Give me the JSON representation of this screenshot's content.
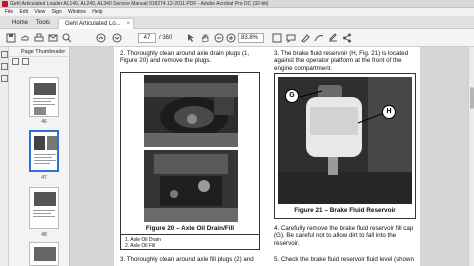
{
  "window": {
    "title": "Gehl Articulated Loader AL140, AL240, AL340 Service Manual 918274 12-2011.PDF - Adobe Acrobat Pro DC (32-bit)"
  },
  "menu": {
    "items": [
      "File",
      "Edit",
      "View",
      "Sign",
      "Window",
      "Help"
    ]
  },
  "tabs": {
    "home": "Home",
    "tools": "Tools",
    "document": "Gehl Articulated Lo...",
    "close": "×"
  },
  "toolbar": {
    "current_page": "47",
    "total_pages": "/ 360",
    "zoom": "83.8%"
  },
  "thumbnails": {
    "header": "Page Thumbnails",
    "close": "×",
    "pages": [
      "46",
      "47",
      "48"
    ]
  },
  "page": {
    "left_step_top": "2.  Thoroughly clean around axle drain plugs (1, Figure 20) and remove the plugs.",
    "figure20_caption": "Figure 20 – Axle Oil Drain/Fill",
    "figure20_legend": [
      "1. Axle Oil Drain",
      "2. Axle Oil Fill"
    ],
    "left_step_bottom": "3.  Thoroughly clean around axle fill plugs (2) and",
    "right_step_top": "3.  The brake fluid reservoir (H, Fig. 21) is located against the operator platform at the front of the engine compartment.",
    "figure21_caption": "Figure 21 – Brake Fluid Reservoir",
    "callout_g": "G",
    "callout_h": "H",
    "right_step_4": "4.  Carefully remove the brake fluid reservoir fill cap (G). Be careful not to allow dirt to fall into the reservoir.",
    "right_step_5": "5.  Check the brake fluid reservoir fluid level (shown"
  }
}
